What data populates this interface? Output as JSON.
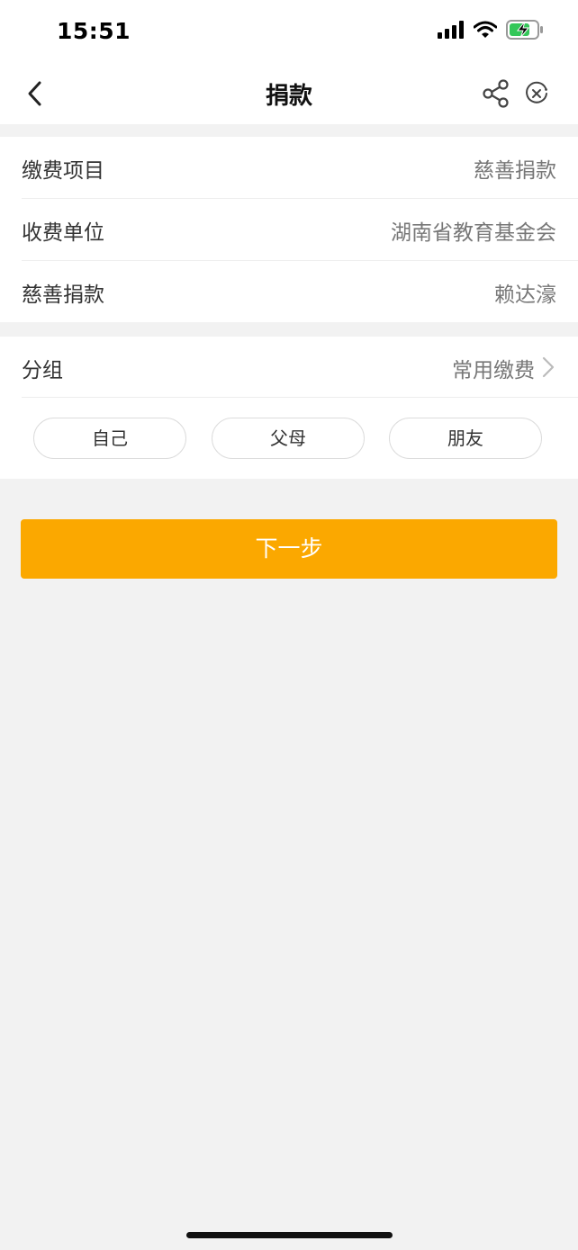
{
  "status_bar": {
    "time": "15:51",
    "icons": [
      "signal-icon",
      "wifi-icon",
      "battery-charging-icon"
    ]
  },
  "nav": {
    "title": "捐款",
    "back_icon": "chevron-left-icon",
    "share_icon": "share-icon",
    "close_icon": "close-circle-icon"
  },
  "info": {
    "rows": [
      {
        "label": "缴费项目",
        "value": "慈善捐款"
      },
      {
        "label": "收费单位",
        "value": "湖南省教育基金会"
      },
      {
        "label": "慈善捐款",
        "value": "赖达濠"
      }
    ]
  },
  "group": {
    "label": "分组",
    "value": "常用缴费",
    "chips": [
      "自己",
      "父母",
      "朋友"
    ]
  },
  "actions": {
    "next_label": "下一步"
  },
  "colors": {
    "accent": "#fba800",
    "background": "#f2f2f2",
    "battery_green": "#34c759"
  }
}
